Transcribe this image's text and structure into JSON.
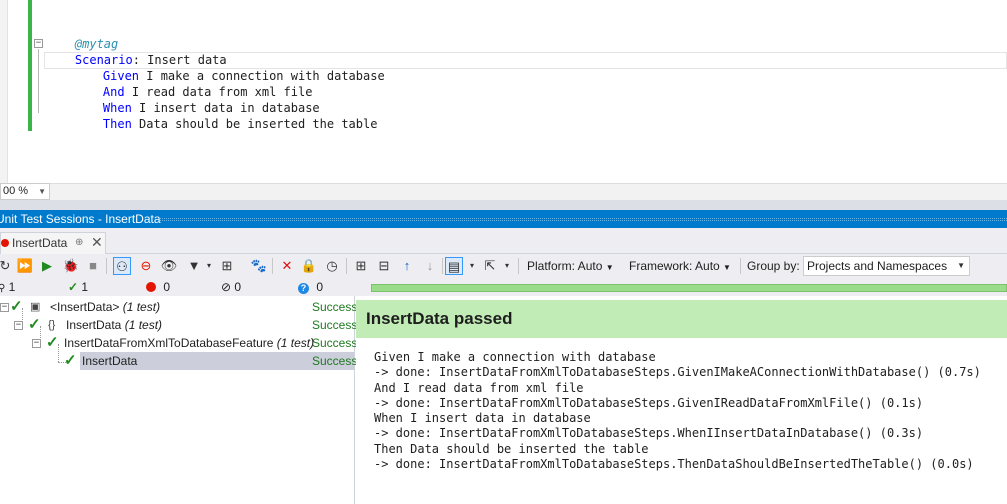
{
  "editor": {
    "tag": "@mytag",
    "scenario_keyword": "Scenario",
    "scenario_rest": ": Insert data",
    "steps": [
      {
        "kw": "Given",
        "text": " I make a connection with database"
      },
      {
        "kw": "And",
        "text": " I read data from xml file"
      },
      {
        "kw": "When",
        "text": " I insert data in database"
      },
      {
        "kw": "Then",
        "text": " Data should be inserted the table"
      }
    ],
    "fold_symbol": "−",
    "zoom": "00 %"
  },
  "tool_window": {
    "title": "Unit Test Sessions - InsertData",
    "tab_label": "InsertData",
    "tab_pin": "⊕",
    "tab_close": "✕"
  },
  "toolbar": {
    "platform": "Platform: Auto",
    "framework": "Framework: Auto",
    "group_by_label": "Group by:",
    "group_by_value": "Projects and Namespaces"
  },
  "counts": {
    "total": "1",
    "passed": "1",
    "failed": "0",
    "ignored": "0",
    "unknown": "0"
  },
  "tree": [
    {
      "label": "<InsertData>",
      "count": "(1 test)",
      "status": "Success"
    },
    {
      "label": "InsertData",
      "count": "(1 test)",
      "status": "Success"
    },
    {
      "label": "InsertDataFromXmlToDatabaseFeature",
      "count": "(1 test)",
      "status": "Success"
    },
    {
      "label": "InsertData",
      "count": "",
      "status": "Success"
    }
  ],
  "output": {
    "header": "InsertData passed",
    "lines": "Given I make a connection with database\n-> done: InsertDataFromXmlToDatabaseSteps.GivenIMakeAConnectionWithDatabase() (0.7s)\nAnd I read data from xml file\n-> done: InsertDataFromXmlToDatabaseSteps.GivenIReadDataFromXmlFile() (0.1s)\nWhen I insert data in database\n-> done: InsertDataFromXmlToDatabaseSteps.WhenIInsertDataInDatabase() (0.3s)\nThen Data should be inserted the table\n-> done: InsertDataFromXmlToDatabaseSteps.ThenDataShouldBeInsertedTheTable() (0.0s)"
  },
  "colors": {
    "accent": "#007acc",
    "success": "#1f8a1f",
    "passed_header": "#c1ecb6",
    "change_bar": "#3bb54a"
  },
  "icons": [
    "run-all-icon",
    "run-icon",
    "debug-icon",
    "stop-icon",
    "show-running-icon",
    "stop-sign-icon",
    "hide-icon",
    "filter-icon",
    "tree-options-icon",
    "dotcover-icon",
    "delete-icon",
    "lock-icon",
    "clock-icon",
    "expand-all-icon",
    "collapse-all-icon",
    "up-arrow-icon",
    "down-arrow-icon",
    "layout-icon",
    "export-icon"
  ]
}
